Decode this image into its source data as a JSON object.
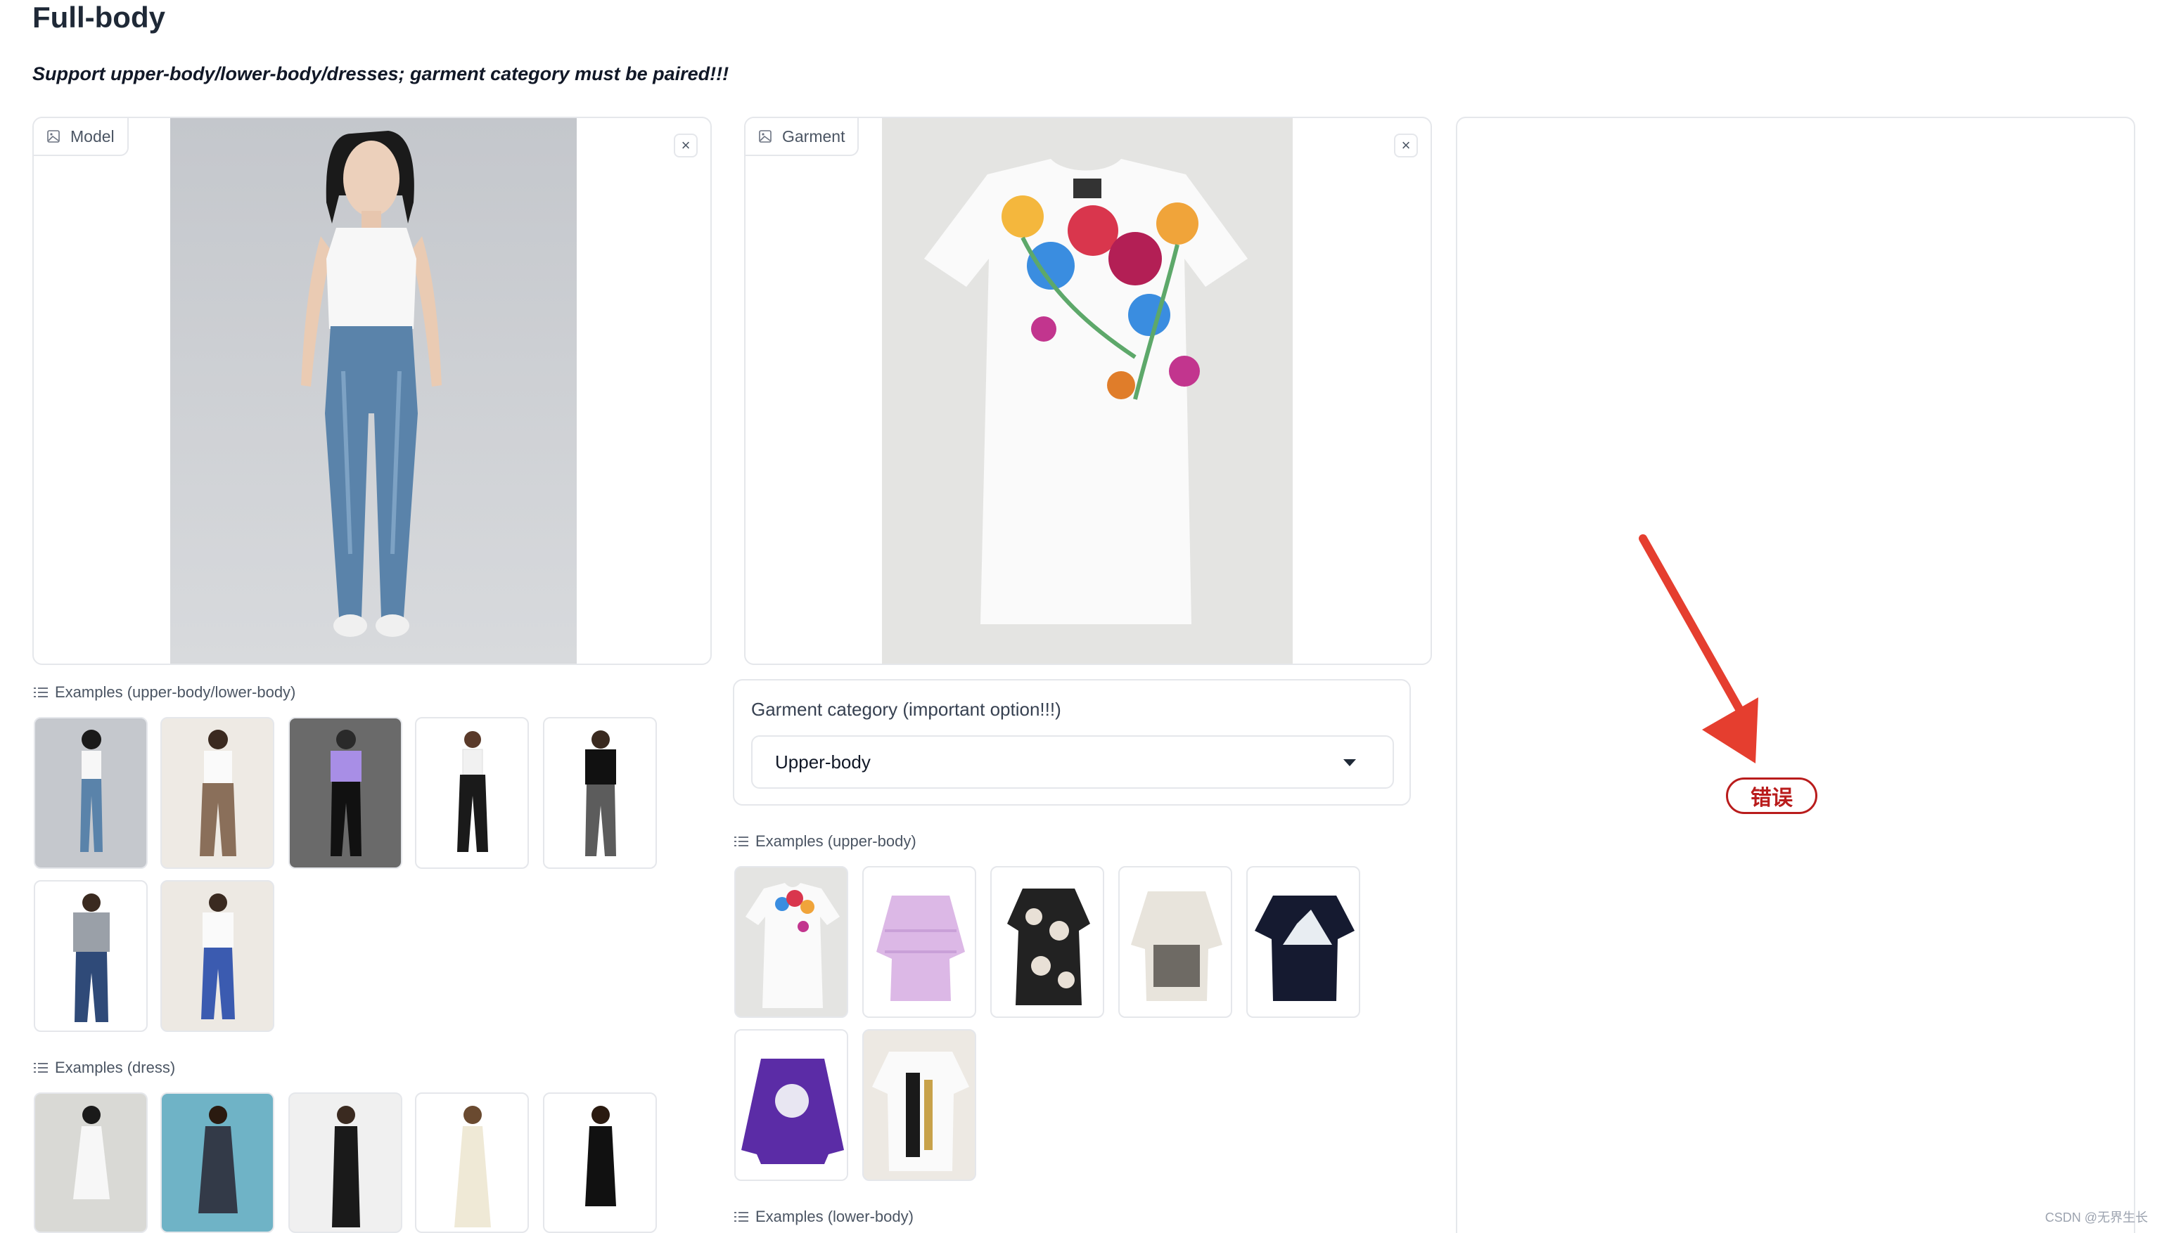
{
  "header": {
    "title": "Full-body",
    "subtitle": "Support upper-body/lower-body/dresses; garment category must be paired!!!"
  },
  "model_panel": {
    "label": "Model",
    "close_glyph": "×"
  },
  "garment_panel": {
    "label": "Garment",
    "close_glyph": "×"
  },
  "examples_model": {
    "label": "Examples (upper-body/lower-body)",
    "count": 7
  },
  "examples_dress": {
    "label": "Examples (dress)",
    "count": 5
  },
  "garment_category": {
    "label": "Garment category (important option!!!)",
    "selected": "Upper-body"
  },
  "examples_upper": {
    "label": "Examples (upper-body)",
    "count": 7
  },
  "examples_lower": {
    "label": "Examples (lower-body)"
  },
  "output_panel": {
    "error_text": "错误"
  },
  "watermark": "CSDN @无界生长",
  "colors": {
    "error": "#b91c1c",
    "arrow": "#e53e2f",
    "border": "#e5e7eb"
  },
  "icons": {
    "image": "image-icon",
    "close": "close-icon",
    "list": "list-icon",
    "dropdown": "caret-down-icon",
    "arrow": "red-arrow-annotation"
  }
}
